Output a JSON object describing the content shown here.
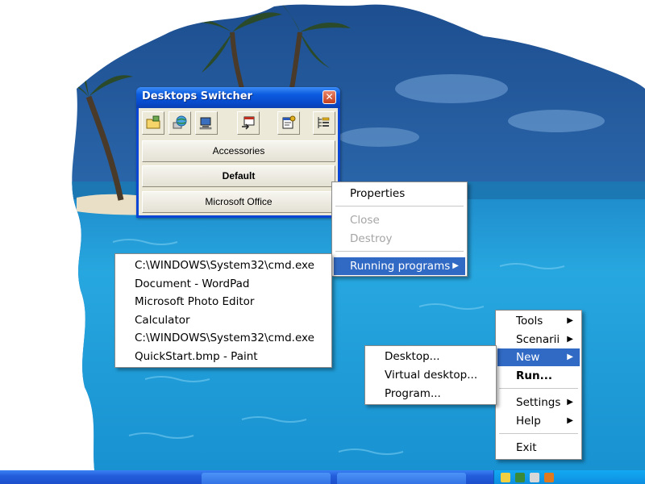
{
  "colors": {
    "titlebar": "#0b5be0",
    "highlight": "#316ac5",
    "disabled_text": "#a5a5a5",
    "menu_background": "#ffffff",
    "window_face": "#ece9d8"
  },
  "window": {
    "title": "Desktops Switcher",
    "close_glyph": "✕",
    "toolbar_icons": [
      "folder-add-icon",
      "globe-icon",
      "desktop-config-icon",
      "switch-desktop-icon",
      "properties-icon",
      "task-list-icon"
    ],
    "groups": [
      {
        "label": "Accessories",
        "bold": false
      },
      {
        "label": "Default",
        "bold": true
      },
      {
        "label": "Microsoft Office",
        "bold": false
      }
    ]
  },
  "context_menu": {
    "properties": "Properties",
    "close": "Close",
    "destroy": "Destroy",
    "running_programs": "Running programs"
  },
  "running_programs": [
    "C:\\WINDOWS\\System32\\cmd.exe",
    "Document - WordPad",
    "Microsoft Photo Editor",
    "Calculator",
    "C:\\WINDOWS\\System32\\cmd.exe",
    "QuickStart.bmp - Paint"
  ],
  "tray_menu": {
    "tools": "Tools",
    "scenarii": "Scenarii",
    "new": "New",
    "run": "Run...",
    "settings": "Settings",
    "help": "Help",
    "exit": "Exit"
  },
  "new_submenu": {
    "desktop": "Desktop...",
    "virtual_desktop": "Virtual desktop...",
    "program": "Program..."
  }
}
